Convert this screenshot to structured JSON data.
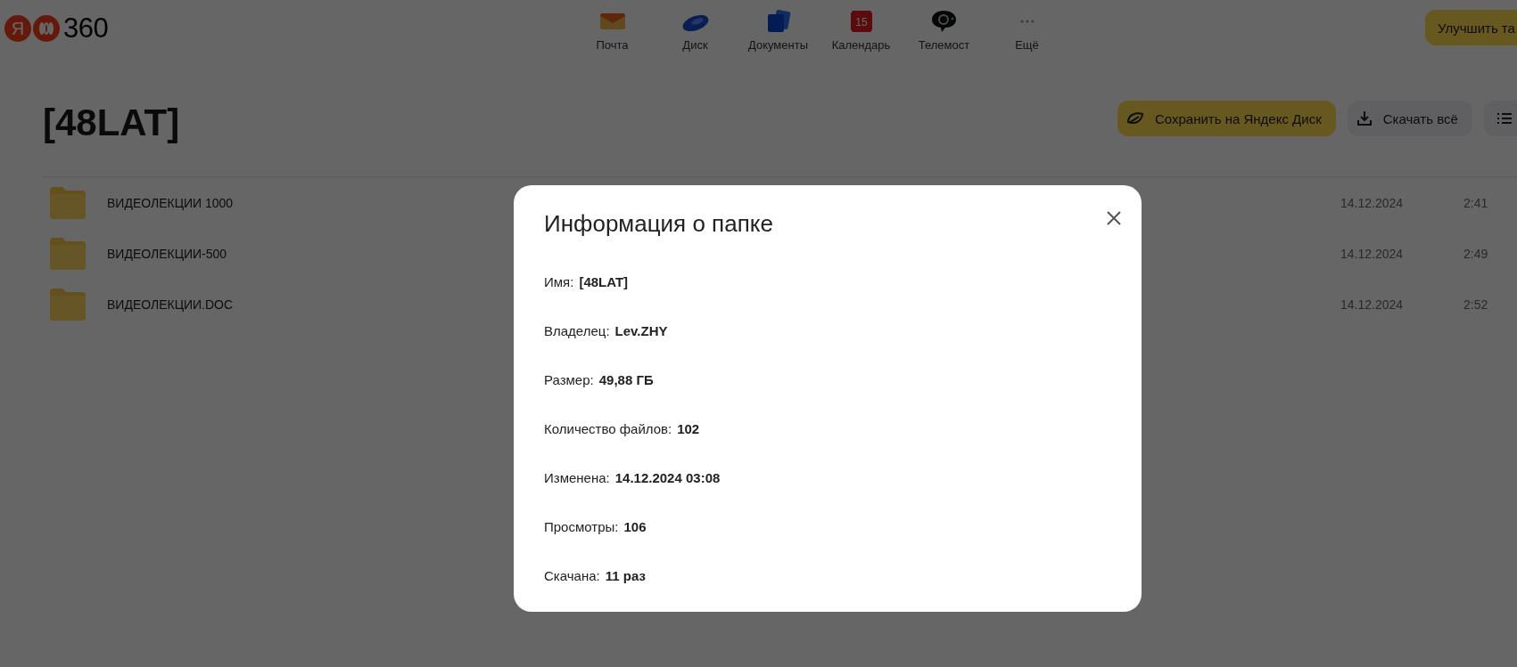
{
  "logo": {
    "mark": "Я",
    "text": "360"
  },
  "services": [
    {
      "label": "Почта",
      "kind": "mail"
    },
    {
      "label": "Диск",
      "kind": "disk"
    },
    {
      "label": "Документы",
      "kind": "docs"
    },
    {
      "label": "Календарь",
      "kind": "calendar",
      "icon_text": "15"
    },
    {
      "label": "Телемост",
      "kind": "telemost"
    },
    {
      "label": "Ещё",
      "kind": "more"
    }
  ],
  "upgrade_button": "Улучшить та",
  "folder_title": "[48LAT]",
  "actions": [
    {
      "label": "Сохранить на Яндекс Диск",
      "kind": "save"
    },
    {
      "label": "Скачать всё",
      "kind": "download"
    },
    {
      "kind": "view"
    }
  ],
  "files": [
    {
      "name": "ВИДЕОЛЕКЦИИ 1000",
      "date": "14.12.2024",
      "time": "2:41"
    },
    {
      "name": "ВИДЕОЛЕКЦИИ-500",
      "date": "14.12.2024",
      "time": "2:49"
    },
    {
      "name": "ВИДЕОЛЕКЦИИ.DOC",
      "date": "14.12.2024",
      "time": "2:52"
    }
  ],
  "dialog": {
    "title": "Информация о папке",
    "fields": [
      {
        "label": "Имя:",
        "value": "[48LAT]"
      },
      {
        "label": "Владелец:",
        "value": "Lev.ZHY"
      },
      {
        "label": "Размер:",
        "value": "49,88 ГБ"
      },
      {
        "label": "Количество файлов:",
        "value": "102"
      },
      {
        "label": "Изменена:",
        "value": "14.12.2024 03:08"
      },
      {
        "label": "Просмотры:",
        "value": "106"
      },
      {
        "label": "Скачана:",
        "value": "11 раз"
      }
    ]
  }
}
